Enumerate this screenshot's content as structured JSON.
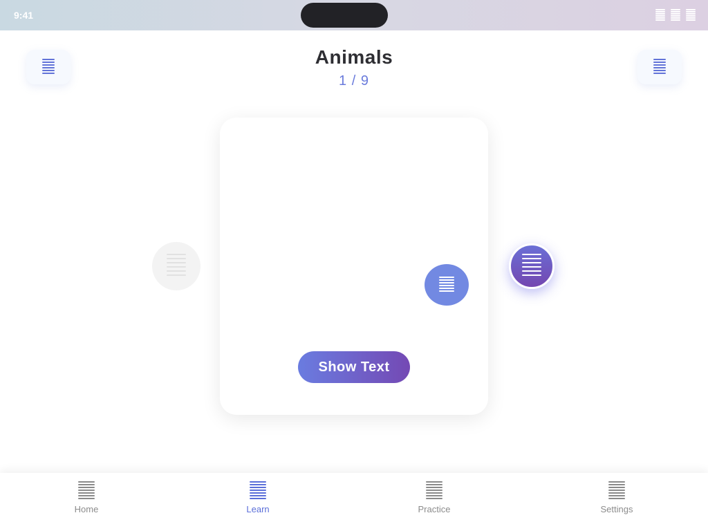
{
  "status_bar": {
    "time": "9:41",
    "icons": [
      "signal-icon",
      "wifi-icon",
      "battery-icon"
    ]
  },
  "header": {
    "title": "Animals",
    "counter": "1 / 9",
    "left_icon": "menu-icon",
    "right_icon": "list-icon"
  },
  "card": {
    "audio_icon": "speaker-icon",
    "show_text_label": "Show Text"
  },
  "navigation": {
    "prev_icon": "chevron-left-icon",
    "next_icon": "chevron-right-icon"
  },
  "tabs": [
    {
      "label": "Home",
      "icon": "home-icon",
      "active": false
    },
    {
      "label": "Learn",
      "icon": "book-icon",
      "active": true
    },
    {
      "label": "Practice",
      "icon": "practice-icon",
      "active": false
    },
    {
      "label": "Settings",
      "icon": "gear-icon",
      "active": false
    }
  ],
  "colors": {
    "accent": "#6a7ce0",
    "accent_deep": "#7449b4",
    "tab_active": "#5b6fd9",
    "tab_inactive": "#8c8c8c",
    "prev_disabled": "#f3f3f3"
  }
}
